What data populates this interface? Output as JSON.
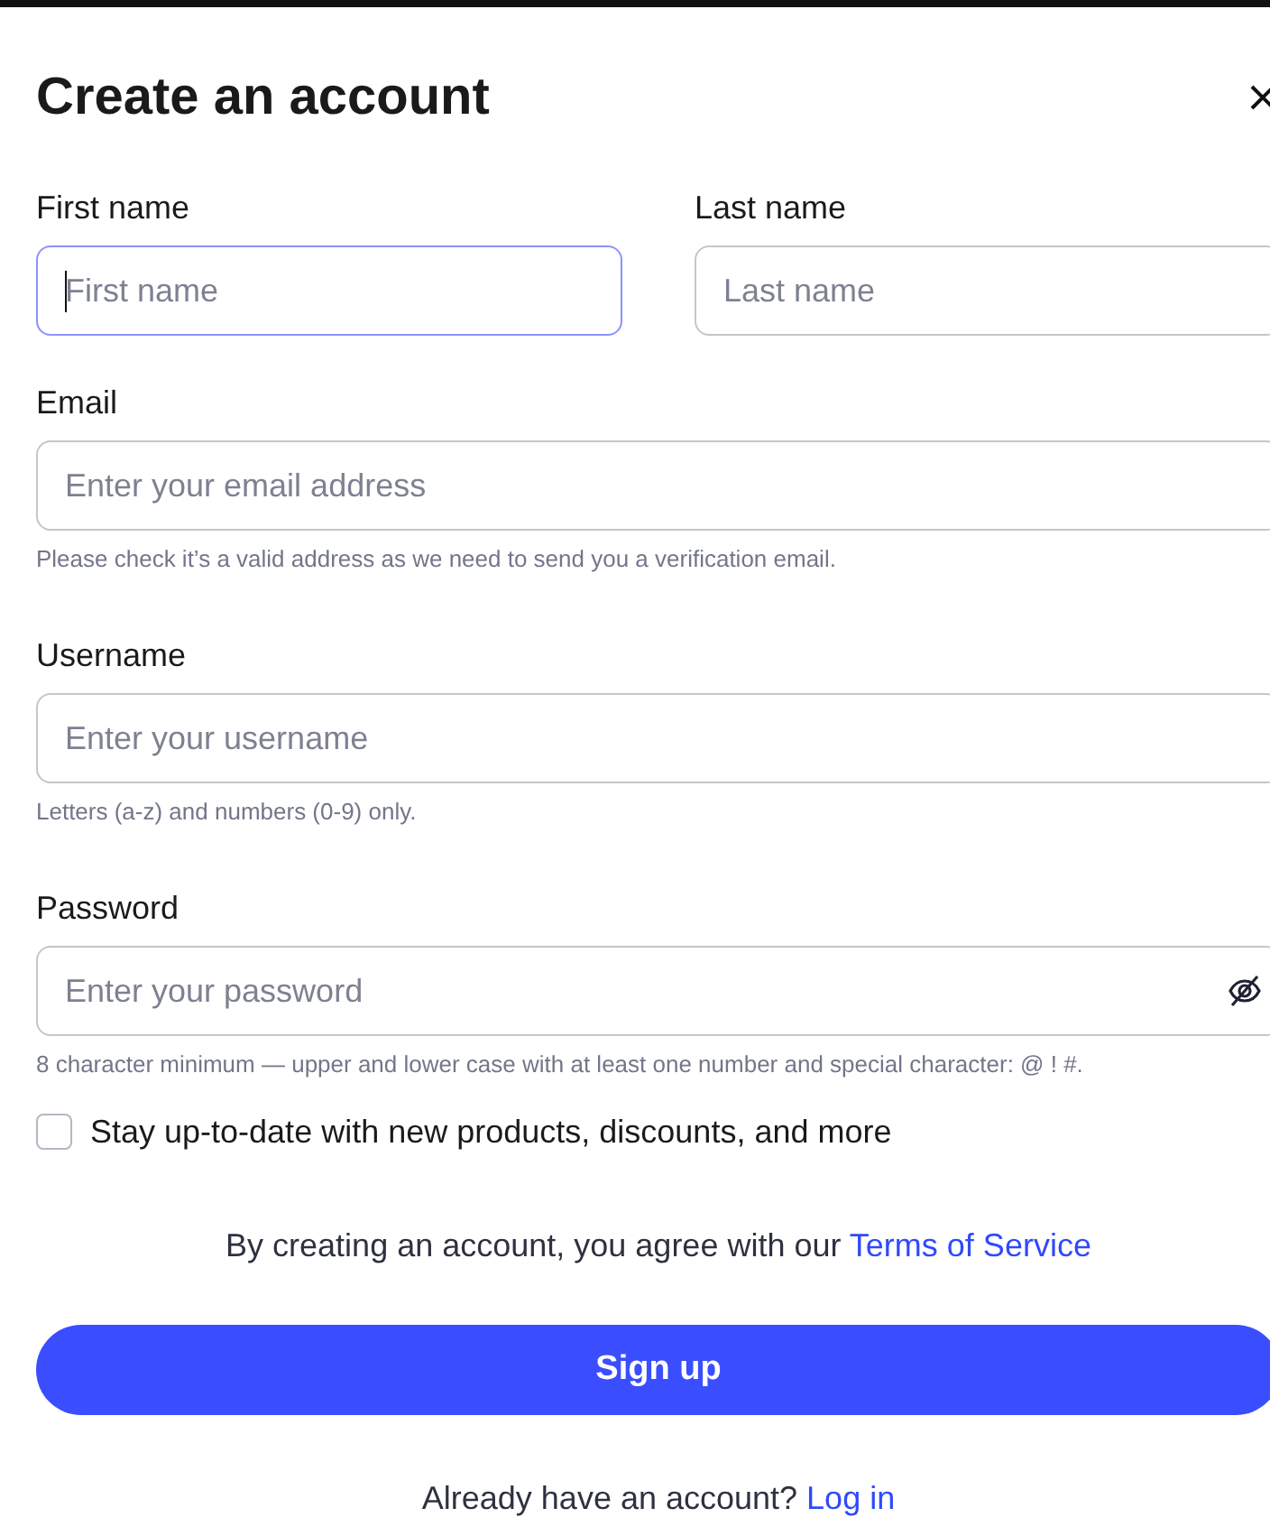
{
  "dialog": {
    "title": "Create an account"
  },
  "name_fields": [
    {
      "label": "First name",
      "placeholder": "First name",
      "focused": true
    },
    {
      "label": "Last name",
      "placeholder": "Last name",
      "focused": false
    }
  ],
  "fields": [
    {
      "kind": "text",
      "label": "Email",
      "placeholder": "Enter your email address",
      "hint": "Please check it’s a valid address as we need to send you a verification email."
    },
    {
      "kind": "text",
      "label": "Username",
      "placeholder": "Enter your username",
      "hint": "Letters (a-z) and numbers (0-9) only."
    },
    {
      "kind": "password",
      "label": "Password",
      "placeholder": "Enter your password",
      "hint": "8 character minimum — upper and lower case with at least one number and special character: @ ! #."
    }
  ],
  "newsletter": {
    "label": "Stay up-to-date with new products, discounts, and more",
    "checked": false
  },
  "terms": {
    "text": "By creating an account, you agree with our",
    "link": "Terms of Service"
  },
  "submit": "Sign up",
  "login": {
    "text": "Already have an account?",
    "link": "Log in"
  }
}
